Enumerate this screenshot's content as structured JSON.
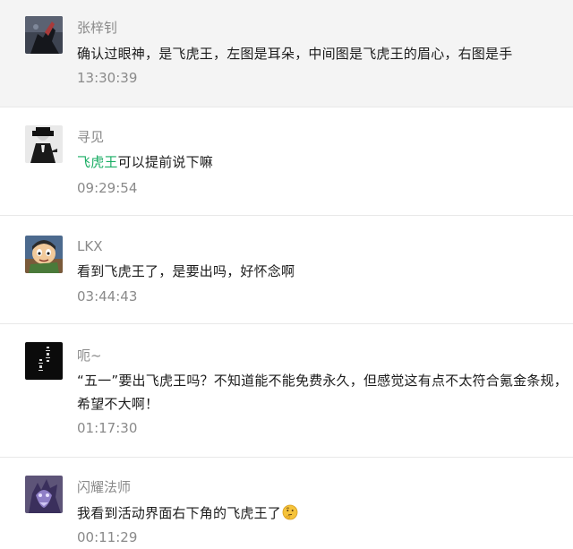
{
  "comments": [
    {
      "name": "张梓钊",
      "text": "确认过眼神，是飞虎王，左图是耳朵，中间图是飞虎王的眉心，右图是手",
      "time": "13:30:39",
      "avatar": "dark-silhouette-avatar"
    },
    {
      "name": "寻见",
      "mention": "飞虎王",
      "text": "可以提前说下嘛",
      "time": "09:29:54",
      "avatar": "hat-figure-avatar"
    },
    {
      "name": "LKX",
      "text": "看到飞虎王了，是要出吗，好怀念啊",
      "time": "03:44:43",
      "avatar": "cartoon-boy-avatar"
    },
    {
      "name": "呃~",
      "text": "“五一”要出飞虎王吗？不知道能不能免费永久，但感觉这有点不太符合氪金条规，希望不大啊！",
      "time": "01:17:30",
      "avatar": "black-calligraphy-avatar"
    },
    {
      "name": "闪耀法师",
      "text": "我看到活动界面右下角的飞虎王了",
      "emoji": "thinking-face-emoji",
      "time": "00:11:29",
      "avatar": "purple-dragon-avatar"
    }
  ],
  "colors": {
    "mention": "#1aad64",
    "name": "#8a8a8a",
    "time": "#8a8a8a",
    "text": "#1b1b1b",
    "highlight_bg": "#f4f4f4",
    "divider": "#e8e8e8"
  }
}
